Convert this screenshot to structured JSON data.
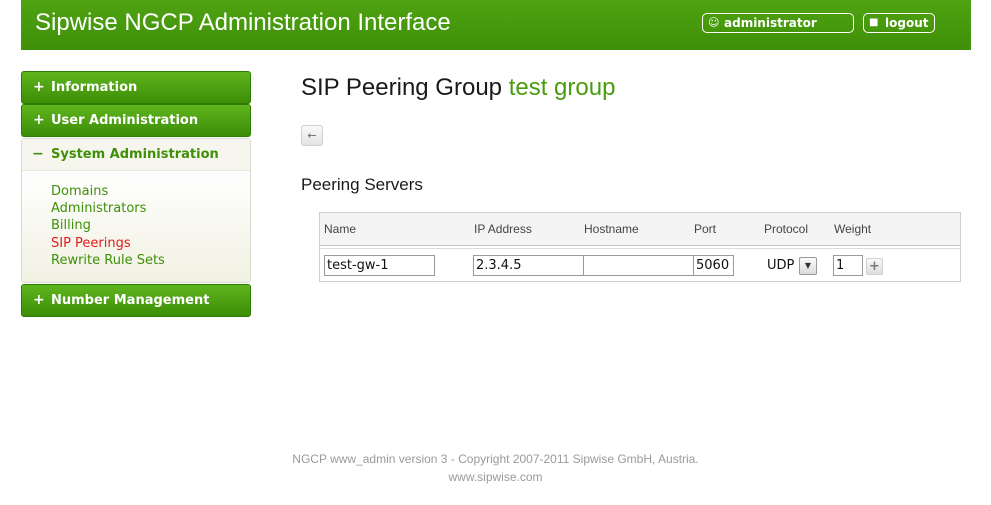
{
  "header": {
    "title": "Sipwise NGCP Administration Interface",
    "user": "administrator",
    "user_icon": "user-icon",
    "logout_label": "logout",
    "logout_icon": "lock-icon",
    "brand_color": "#4a9b0e"
  },
  "sidebar": {
    "collapsed_sign": "+",
    "expanded_sign": "−",
    "sections": [
      {
        "label": "Information",
        "expanded": false
      },
      {
        "label": "User Administration",
        "expanded": false
      },
      {
        "label": "System Administration",
        "expanded": true
      },
      {
        "label": "Number Management",
        "expanded": false
      }
    ],
    "system_items": [
      {
        "label": "Domains",
        "active": false
      },
      {
        "label": "Administrators",
        "active": false
      },
      {
        "label": "Billing",
        "active": false
      },
      {
        "label": "SIP Peerings",
        "active": true
      },
      {
        "label": "Rewrite Rule Sets",
        "active": false
      }
    ],
    "active_color": "#e01b1b"
  },
  "main": {
    "title_prefix": "SIP Peering Group",
    "title_name": "test group",
    "back_icon": "arrow-left-icon",
    "section_title": "Peering Servers",
    "table": {
      "columns": [
        "Name",
        "IP Address",
        "Hostname",
        "Port",
        "Protocol",
        "Weight"
      ],
      "row": {
        "name": "test-gw-1",
        "ip": "2.3.4.5",
        "hostname": "",
        "port": "5060",
        "protocol": "UDP",
        "weight": "1"
      },
      "add_icon": "plus-icon"
    }
  },
  "footer": {
    "line1": "NGCP www_admin version 3 - Copyright 2007-2011 Sipwise GmbH, Austria.",
    "line2": "www.sipwise.com"
  }
}
